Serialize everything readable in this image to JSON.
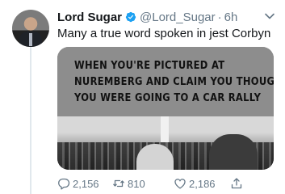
{
  "tweet": {
    "author_name": "Lord Sugar",
    "handle": "@Lord_Sugar",
    "separator": "·",
    "time": "6h",
    "text": "Many a true word spoken in jest Corbyn",
    "verified": true
  },
  "media": {
    "caption_lines": [
      "WHEN YOU'RE PICTURED AT",
      "NUREMBERG AND CLAIM YOU THOUGHT",
      "YOU WERE GOING TO A CAR RALLY"
    ]
  },
  "actions": {
    "reply_count": "2,156",
    "retweet_count": "810",
    "like_count": "2,186"
  },
  "icons": {
    "verified": "verified-badge-icon",
    "caret": "chevron-down-icon",
    "reply": "reply-icon",
    "retweet": "retweet-icon",
    "like": "heart-icon",
    "share": "share-icon"
  },
  "colors": {
    "verified_blue": "#1da1f2",
    "secondary_text": "#657786",
    "primary_text": "#14171a"
  }
}
